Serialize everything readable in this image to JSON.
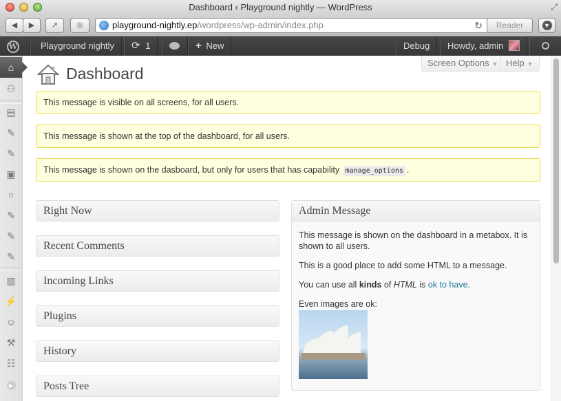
{
  "window": {
    "title": "Dashboard ‹ Playground nightly — WordPress"
  },
  "toolbar": {
    "back_label": "◀",
    "forward_label": "▶",
    "share_label": "↗",
    "url_host": "playground-nightly.ep",
    "url_path": "/wordpress/wp-admin/index.php",
    "reload_label": "↻",
    "reader_label": "Reader"
  },
  "adminbar": {
    "site_name": "Playground nightly",
    "updates_count": "1",
    "new_label": "New",
    "debug_label": "Debug",
    "howdy_label": "Howdy, admin"
  },
  "left_menu": {
    "items": [
      "dashboard",
      "updates",
      "posts",
      "media",
      "links",
      "pages",
      "comments",
      "custom-1",
      "custom-2",
      "custom-3",
      "appearance",
      "plugins",
      "users",
      "tools",
      "settings",
      "collapse"
    ]
  },
  "screen_meta": {
    "screen_options_label": "Screen Options",
    "help_label": "Help"
  },
  "page": {
    "title": "Dashboard"
  },
  "notices": [
    {
      "text": "This message is visible on all screens, for all users."
    },
    {
      "text": "This message is shown at the top of the dashboard, for all users."
    },
    {
      "text_before": "This message is shown on the dasboard, but only for users that has capability",
      "code": "manage_options",
      "text_after": "."
    }
  ],
  "postboxes": [
    {
      "title": "Right Now"
    },
    {
      "title": "Recent Comments"
    },
    {
      "title": "Incoming Links"
    },
    {
      "title": "Plugins"
    },
    {
      "title": "History"
    },
    {
      "title": "Posts Tree"
    }
  ],
  "admin_message": {
    "title": "Admin Message",
    "p1": "This message is shown on the dashboard in a metabox. It is shown to all users.",
    "p2": "This is a good place to add some HTML to a message.",
    "p3_before": "You can use all ",
    "p3_bold": "kinds",
    "p3_middle": " of ",
    "p3_italic": "HTML",
    "p3_is": " is ",
    "p3_link": "ok to have",
    "p3_after": ".",
    "p4": "Even images are ok:"
  },
  "colors": {
    "notice_bg": "#ffffe0",
    "notice_border": "#e6db55",
    "adminbar_bg": "#464646",
    "link": "#21759b"
  }
}
